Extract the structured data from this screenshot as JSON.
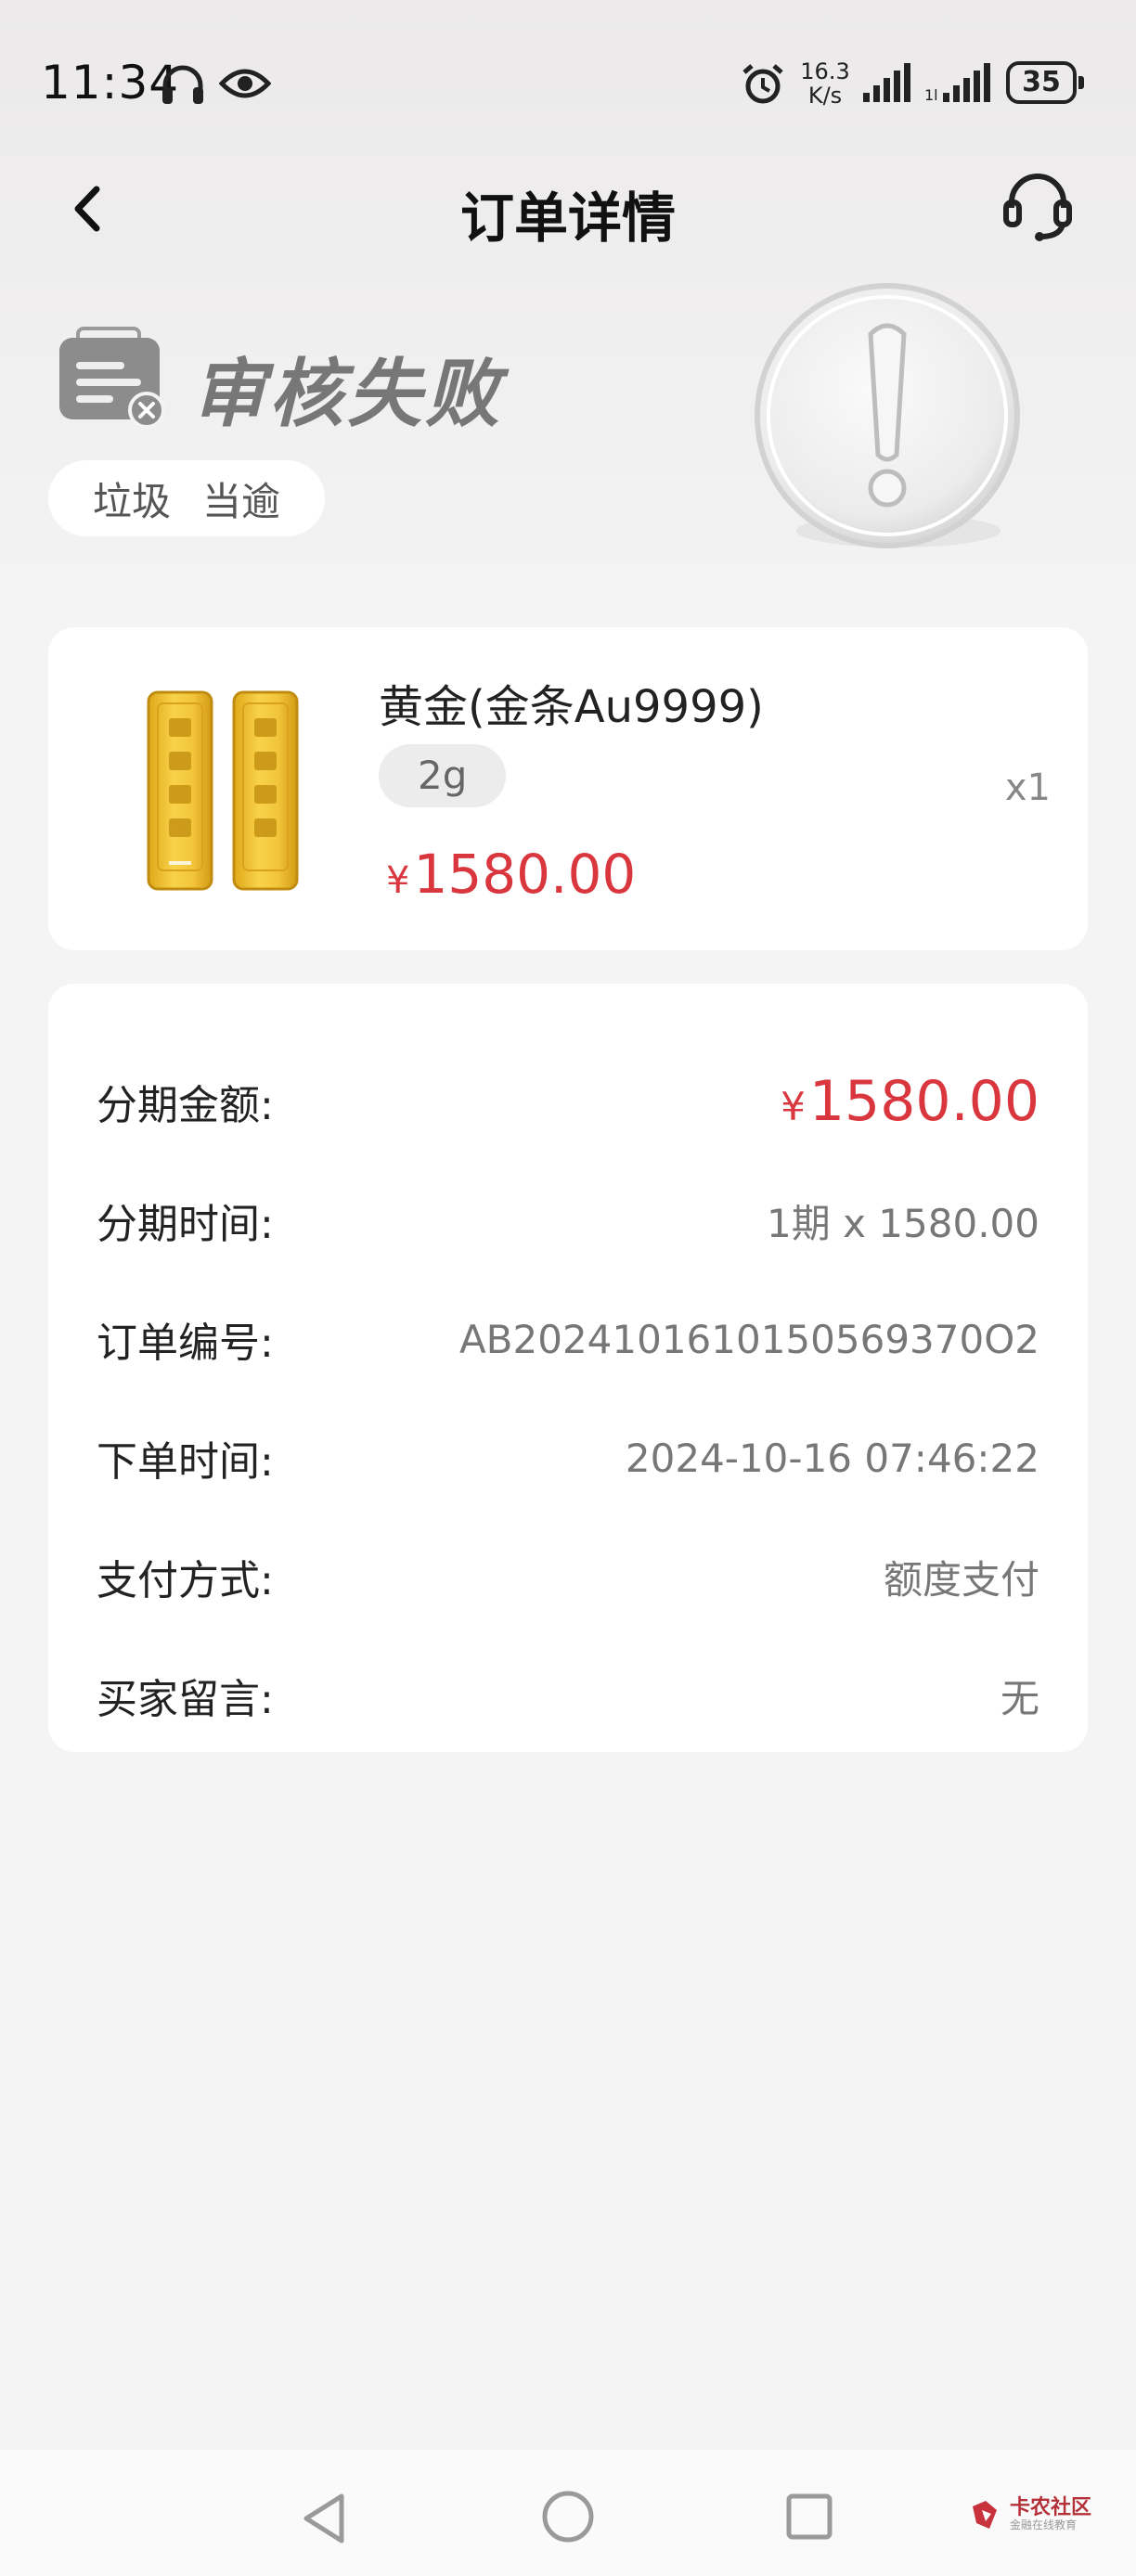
{
  "status_bar": {
    "time": "11:34",
    "net_speed_value": "16.3",
    "net_speed_unit": "K/s",
    "battery": "35",
    "icons": [
      "headphones-icon",
      "eye-icon",
      "alarm-icon",
      "signal-icon",
      "signal-icon",
      "battery-icon"
    ]
  },
  "nav": {
    "title": "订单详情",
    "back_icon": "chevron-left-icon",
    "service_icon": "headset-icon"
  },
  "order_status": {
    "title": "审核失败",
    "tags": [
      "垃圾",
      "当逾"
    ],
    "icon": "document-icon",
    "badge_icon": "exclamation-circle-icon"
  },
  "product": {
    "name": "黄金(金条Au9999)",
    "spec": "2g",
    "currency": "¥",
    "price": "1580.00",
    "quantity": "x1",
    "image": "gold-bar-image"
  },
  "details": {
    "rows": [
      {
        "label": "分期金额:",
        "value": "1580.00",
        "currency": "¥"
      },
      {
        "label": "分期时间:",
        "value": "1期 x 1580.00"
      },
      {
        "label": "订单编号:",
        "value": "AB2024101610150569370O2"
      },
      {
        "label": "下单时间:",
        "value": "2024-10-16 07:46:22"
      },
      {
        "label": "支付方式:",
        "value": "额度支付"
      },
      {
        "label": "买家留言:",
        "value": "无"
      }
    ]
  },
  "watermark": {
    "title": "卡农社区",
    "subtitle": "金融在线教育"
  },
  "colors": {
    "accent_red": "#d9363e",
    "background": "#f4f4f4",
    "card": "#ffffff"
  }
}
